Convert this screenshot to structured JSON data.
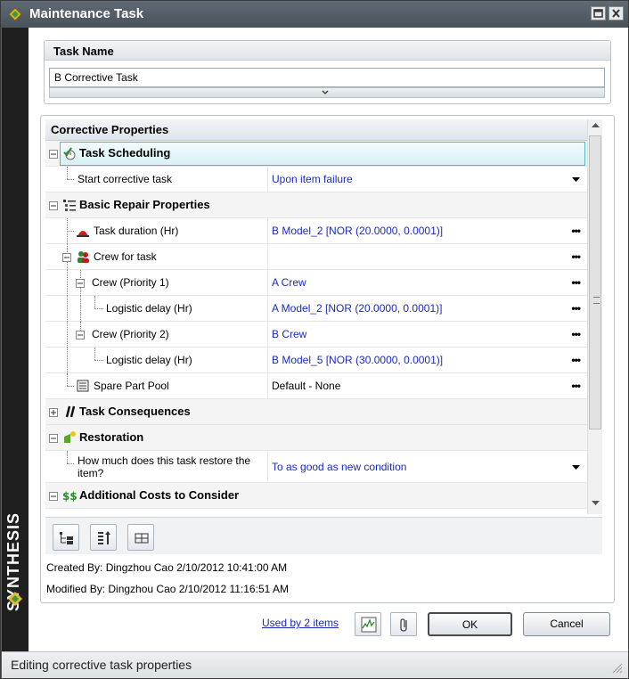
{
  "window": {
    "title": "Maintenance Task",
    "brand": "SYNTHESIS"
  },
  "task_name": {
    "header": "Task Name",
    "value": "B Corrective Task"
  },
  "properties": {
    "header": "Corrective Properties",
    "task_scheduling": {
      "label": "Task Scheduling",
      "start_label": "Start corrective task",
      "start_value": "Upon item failure"
    },
    "basic_repair": {
      "label": "Basic Repair Properties",
      "duration_label": "Task duration (Hr)",
      "duration_value": "B Model_2 [NOR (20.0000, 0.0001)]",
      "crew_label": "Crew for task",
      "crew1_label": "Crew (Priority 1)",
      "crew1_value": "A Crew",
      "crew1_delay_label": "Logistic delay (Hr)",
      "crew1_delay_value": "A Model_2 [NOR (20.0000, 0.0001)]",
      "crew2_label": "Crew (Priority 2)",
      "crew2_value": "B Crew",
      "crew2_delay_label": "Logistic delay (Hr)",
      "crew2_delay_value": "B Model_5 [NOR (30.0000, 0.0001)]",
      "spare_label": "Spare Part Pool",
      "spare_value": "Default - None"
    },
    "task_consequences": {
      "label": "Task Consequences"
    },
    "restoration": {
      "label": "Restoration",
      "restore_label": "How much does this task restore the item?",
      "restore_value": "To as good as new condition"
    },
    "additional_costs": {
      "label": "Additional Costs to Consider"
    },
    "ellipsis": "•••"
  },
  "audit": {
    "created": "Created By:  Dingzhou Cao 2/10/2012 10:41:00 AM",
    "modified": "Modified By: Dingzhou Cao 2/10/2012 11:16:51 AM"
  },
  "footer": {
    "used_by": "Used by 2 items",
    "ok": "OK",
    "cancel": "Cancel"
  },
  "status": {
    "text": "Editing corrective task properties"
  },
  "colors": {
    "value_blue": "#1a2bbf",
    "selection": "#52b6c8"
  }
}
